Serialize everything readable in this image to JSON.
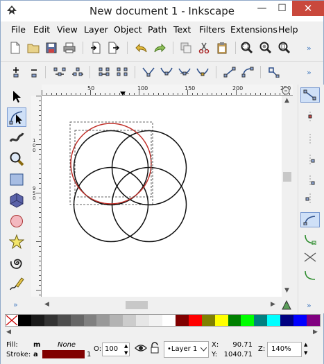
{
  "window": {
    "title": "New document 1 - Inkscape",
    "controls": {
      "minimize": "—",
      "maximize": "☐",
      "close": "✕"
    }
  },
  "menu": [
    "File",
    "Edit",
    "View",
    "Layer",
    "Object",
    "Path",
    "Text",
    "Filters",
    "Extensions",
    "Help"
  ],
  "ruler": {
    "top_labels": [
      "50",
      "100",
      "150",
      "200",
      "250"
    ],
    "left_labels": [
      "1 0 0",
      "9 5 0"
    ]
  },
  "statusbar": {
    "fill_label": "Fill:",
    "fill_value": "m",
    "fill_kind": "None",
    "stroke_label": "Stroke:",
    "stroke_value": "a",
    "stroke_width": "1",
    "opacity_label": "O:",
    "opacity_value": "100",
    "layer": "•Layer 1",
    "x_label": "X:",
    "x_value": "90.71",
    "y_label": "Y:",
    "y_value": "1040.71",
    "zoom_label": "Z:",
    "zoom_value": "140%"
  },
  "palette": [
    "#000000",
    "#1a1a1a",
    "#333333",
    "#4d4d4d",
    "#666666",
    "#808080",
    "#999999",
    "#b3b3b3",
    "#cccccc",
    "#e6e6e6",
    "#f2f2f2",
    "#ffffff",
    "#800000",
    "#ff0000",
    "#808000",
    "#ffff00",
    "#008000",
    "#00ff00",
    "#008080",
    "#00ffff",
    "#000080",
    "#0000ff",
    "#800080"
  ],
  "colors": {
    "accent": "#4a7fc1",
    "stroke": "#800000",
    "selected_circle": "#c0302a"
  }
}
